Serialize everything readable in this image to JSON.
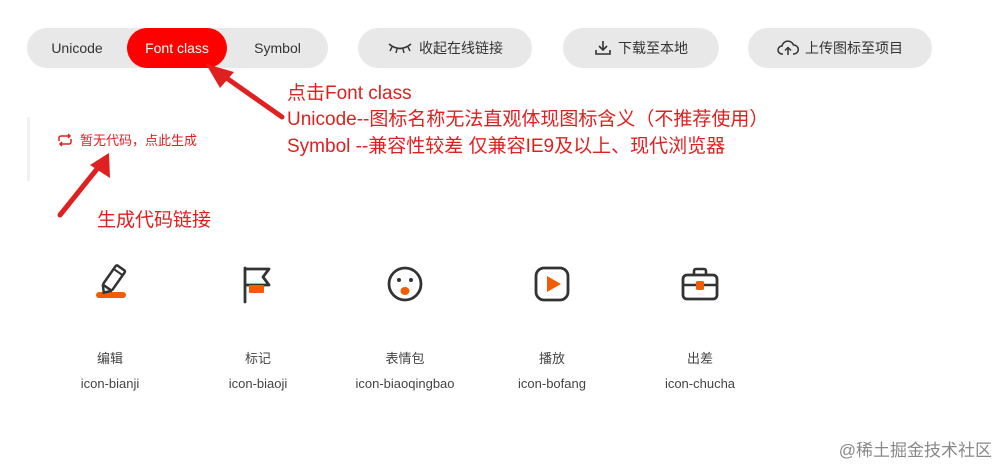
{
  "tabs": {
    "unicode": "Unicode",
    "font_class": "Font class",
    "symbol": "Symbol",
    "selected": "Font class"
  },
  "toolbar": {
    "collapse_label": "收起在线链接",
    "download_label": "下载至本地",
    "upload_label": "上传图标至项目"
  },
  "code_panel": {
    "generate_label": "暂无代码，点此生成"
  },
  "annotations": {
    "line1": "点击Font class",
    "line2": "Unicode--图标名称无法直观体现图标含义（不推荐使用）",
    "line3": "Symbol --兼容性较差 仅兼容IE9及以上、现代浏览器",
    "gen_note": "生成代码链接"
  },
  "icons": [
    {
      "name": "编辑",
      "class": "icon-bianji",
      "glyph": "pencil-icon"
    },
    {
      "name": "标记",
      "class": "icon-biaoji",
      "glyph": "flag-icon"
    },
    {
      "name": "表情包",
      "class": "icon-biaoqingbao",
      "glyph": "emoji-icon"
    },
    {
      "name": "播放",
      "class": "icon-bofang",
      "glyph": "play-icon"
    },
    {
      "name": "出差",
      "class": "icon-chucha",
      "glyph": "briefcase-icon"
    }
  ],
  "watermark": "@稀土掘金技术社区",
  "colors": {
    "accent": "#ff0000",
    "annotation": "#e02020",
    "icon_orange": "#f25c05",
    "pill_bg": "#e8e8e8"
  }
}
